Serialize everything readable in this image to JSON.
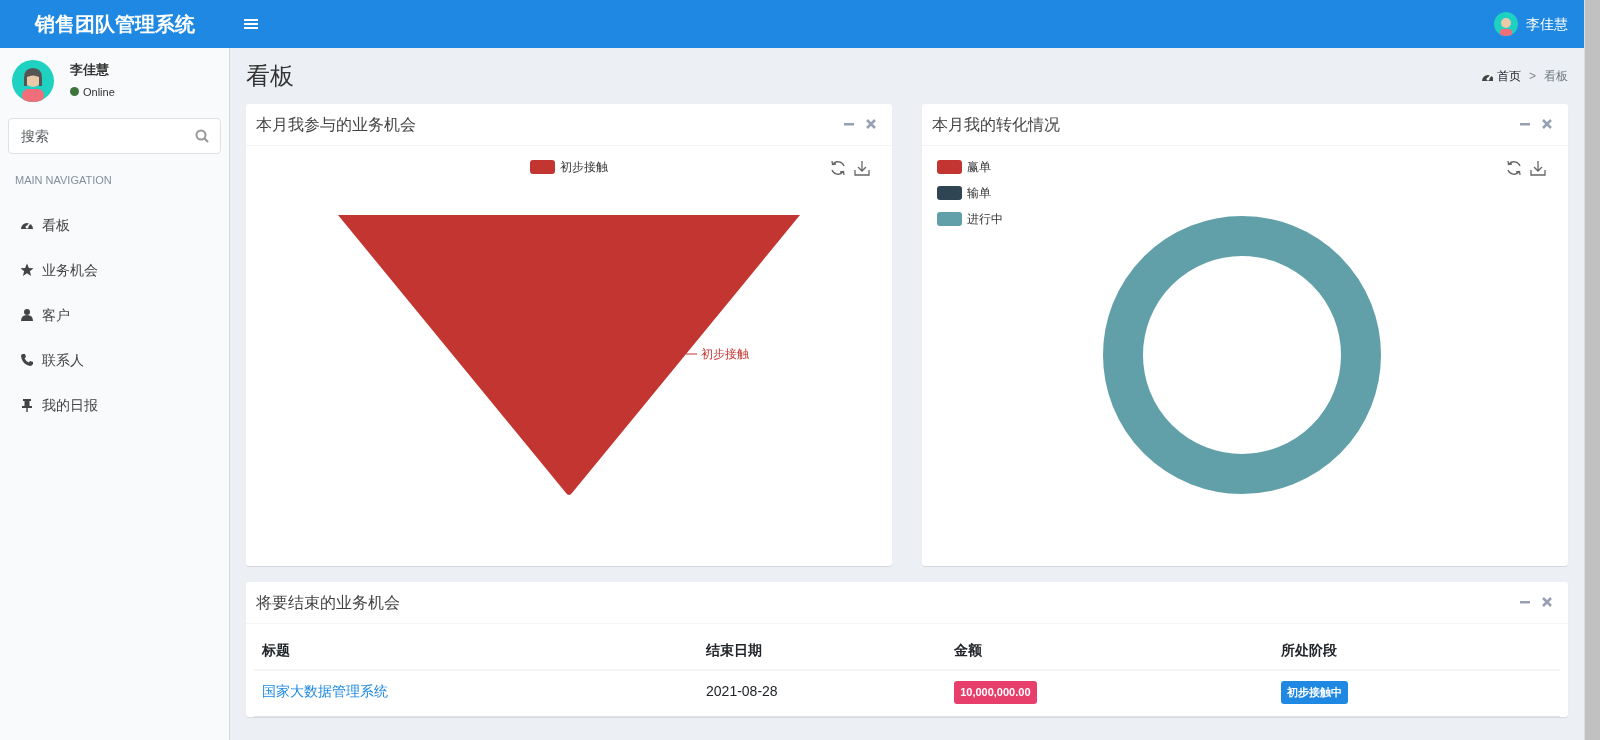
{
  "header": {
    "brand": "销售团队管理系统",
    "user_name": "李佳慧"
  },
  "sidebar": {
    "user": {
      "name": "李佳慧",
      "status": "Online"
    },
    "search": {
      "placeholder": "搜索"
    },
    "section_header": "MAIN NAVIGATION",
    "items": [
      {
        "label": "看板"
      },
      {
        "label": "业务机会"
      },
      {
        "label": "客户"
      },
      {
        "label": "联系人"
      },
      {
        "label": "我的日报"
      }
    ]
  },
  "page": {
    "title": "看板",
    "breadcrumb_separator": ">",
    "breadcrumb": [
      {
        "label": "首页"
      },
      {
        "label": "看板"
      }
    ]
  },
  "funnel_card": {
    "title": "本月我参与的业务机会",
    "legend": [
      {
        "label": "初步接触",
        "color": "#c23531"
      }
    ],
    "slice_label": "初步接触"
  },
  "donut_card": {
    "title": "本月我的转化情况",
    "legend": [
      {
        "label": "赢单",
        "color": "#c23531"
      },
      {
        "label": "输单",
        "color": "#2f4554"
      },
      {
        "label": "进行中",
        "color": "#61a0a8"
      }
    ]
  },
  "table_card": {
    "title": "将要结束的业务机会",
    "columns": [
      "标题",
      "结束日期",
      "金额",
      "所处阶段"
    ],
    "rows": [
      {
        "title": "国家大数据管理系统",
        "end_date": "2021-08-28",
        "amount": "10,000,000.00",
        "stage": "初步接触中"
      }
    ]
  }
}
